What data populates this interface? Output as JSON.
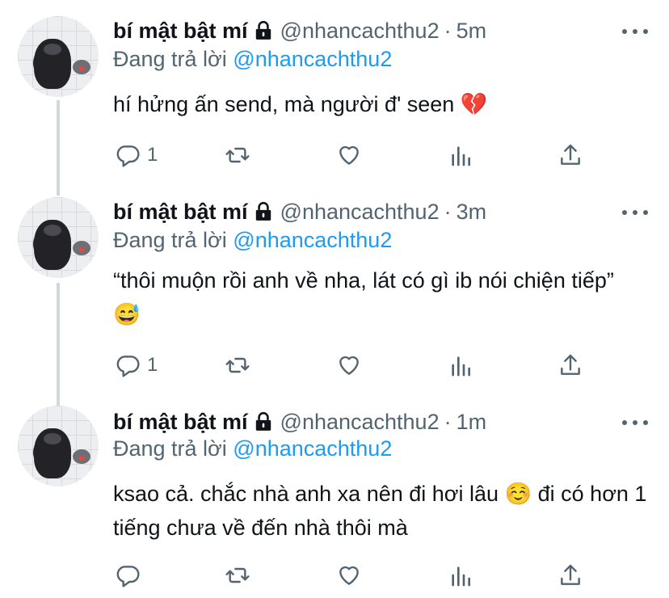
{
  "tweets": [
    {
      "name": "bí mật bật mí",
      "handle": "@nhancachthu2",
      "separator": "·",
      "time": "5m",
      "reply_prefix": "Đang trả lời",
      "reply_to": "@nhancachthu2",
      "text": "hí hửng ấn send, mà người đ' seen 💔",
      "reply_count": "1"
    },
    {
      "name": "bí mật bật mí",
      "handle": "@nhancachthu2",
      "separator": "·",
      "time": "3m",
      "reply_prefix": "Đang trả lời",
      "reply_to": "@nhancachthu2",
      "text": "“thôi muộn rồi anh về nha, lát có gì ib nói chiện tiếp” 😅",
      "reply_count": "1"
    },
    {
      "name": "bí mật bật mí",
      "handle": "@nhancachthu2",
      "separator": "·",
      "time": "1m",
      "reply_prefix": "Đang trả lời",
      "reply_to": "@nhancachthu2",
      "text": "ksao cả. chắc nhà anh xa nên đi hơi lâu ☺️ đi có hơn 1 tiếng chưa về đến nhà thôi mà",
      "reply_count": ""
    }
  ],
  "icons": {
    "lock": "lock-icon",
    "more": "more-icon",
    "reply": "reply-icon",
    "retweet": "retweet-icon",
    "like": "like-icon",
    "analytics": "analytics-icon",
    "share": "share-icon"
  },
  "colors": {
    "text": "#0f1419",
    "secondary": "#536471",
    "accent": "#1d9bf0",
    "thread_line": "#cfd9de"
  }
}
